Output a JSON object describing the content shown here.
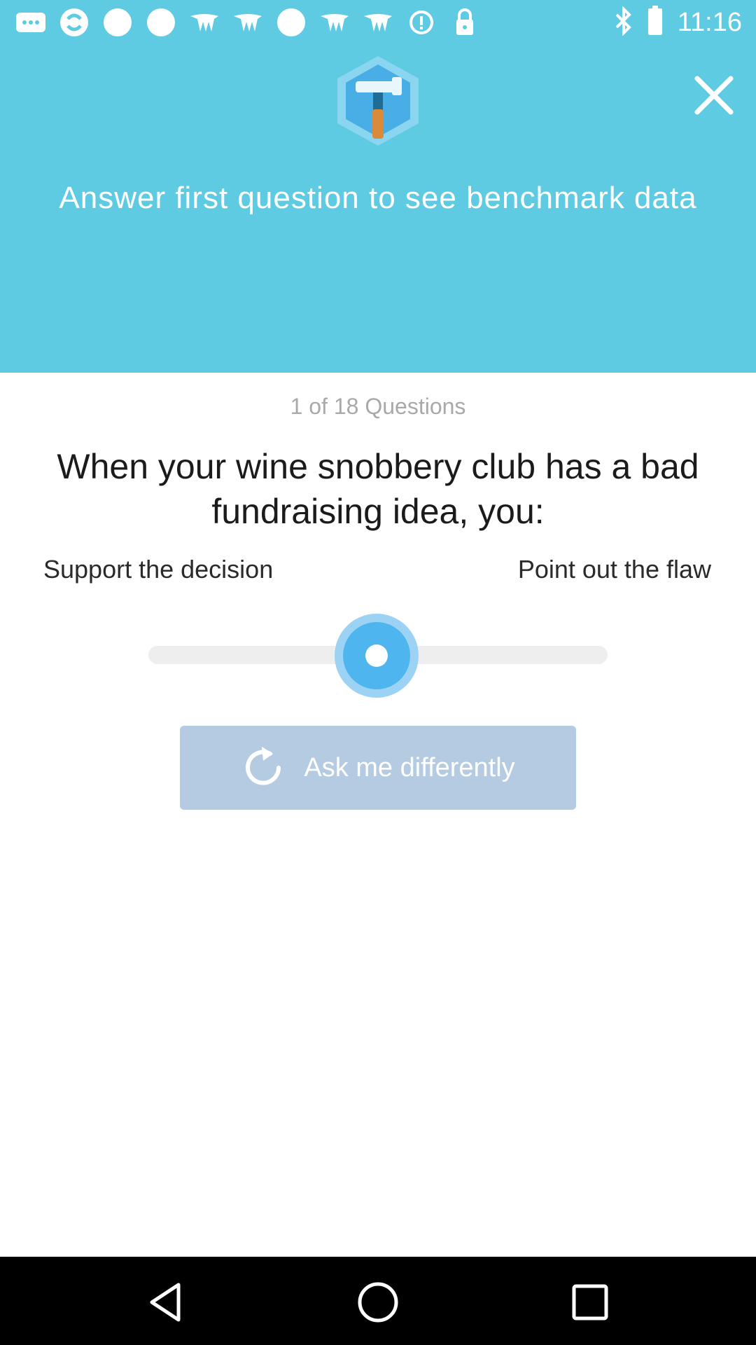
{
  "status_bar": {
    "time": "11:16",
    "icons": [
      "more-notifications-icon",
      "sync-app-icon",
      "circle-notification-icon",
      "circle-notification-icon",
      "wings-app-icon",
      "wings-app-icon",
      "circle-notification-icon",
      "wings-app-icon",
      "wings-app-icon",
      "info-icon",
      "lock-icon",
      "bluetooth-icon",
      "battery-icon"
    ]
  },
  "header": {
    "logo_icon": "hammer-hexagon-icon",
    "close_icon": "close-icon",
    "prompt": "Answer first question to see benchmark data",
    "background_color": "#5ecbe3"
  },
  "quiz": {
    "counter": "1 of 18 Questions",
    "question": "When your wine snobbery club has a bad fundraising idea, you:",
    "left_label": "Support the decision",
    "right_label": "Point out the flaw",
    "slider_value": 0.5,
    "ask_button_label": "Ask me differently",
    "ask_button_icon": "refresh-icon"
  },
  "nav_bar": {
    "icons": [
      "back-icon",
      "home-icon",
      "recents-icon"
    ]
  }
}
